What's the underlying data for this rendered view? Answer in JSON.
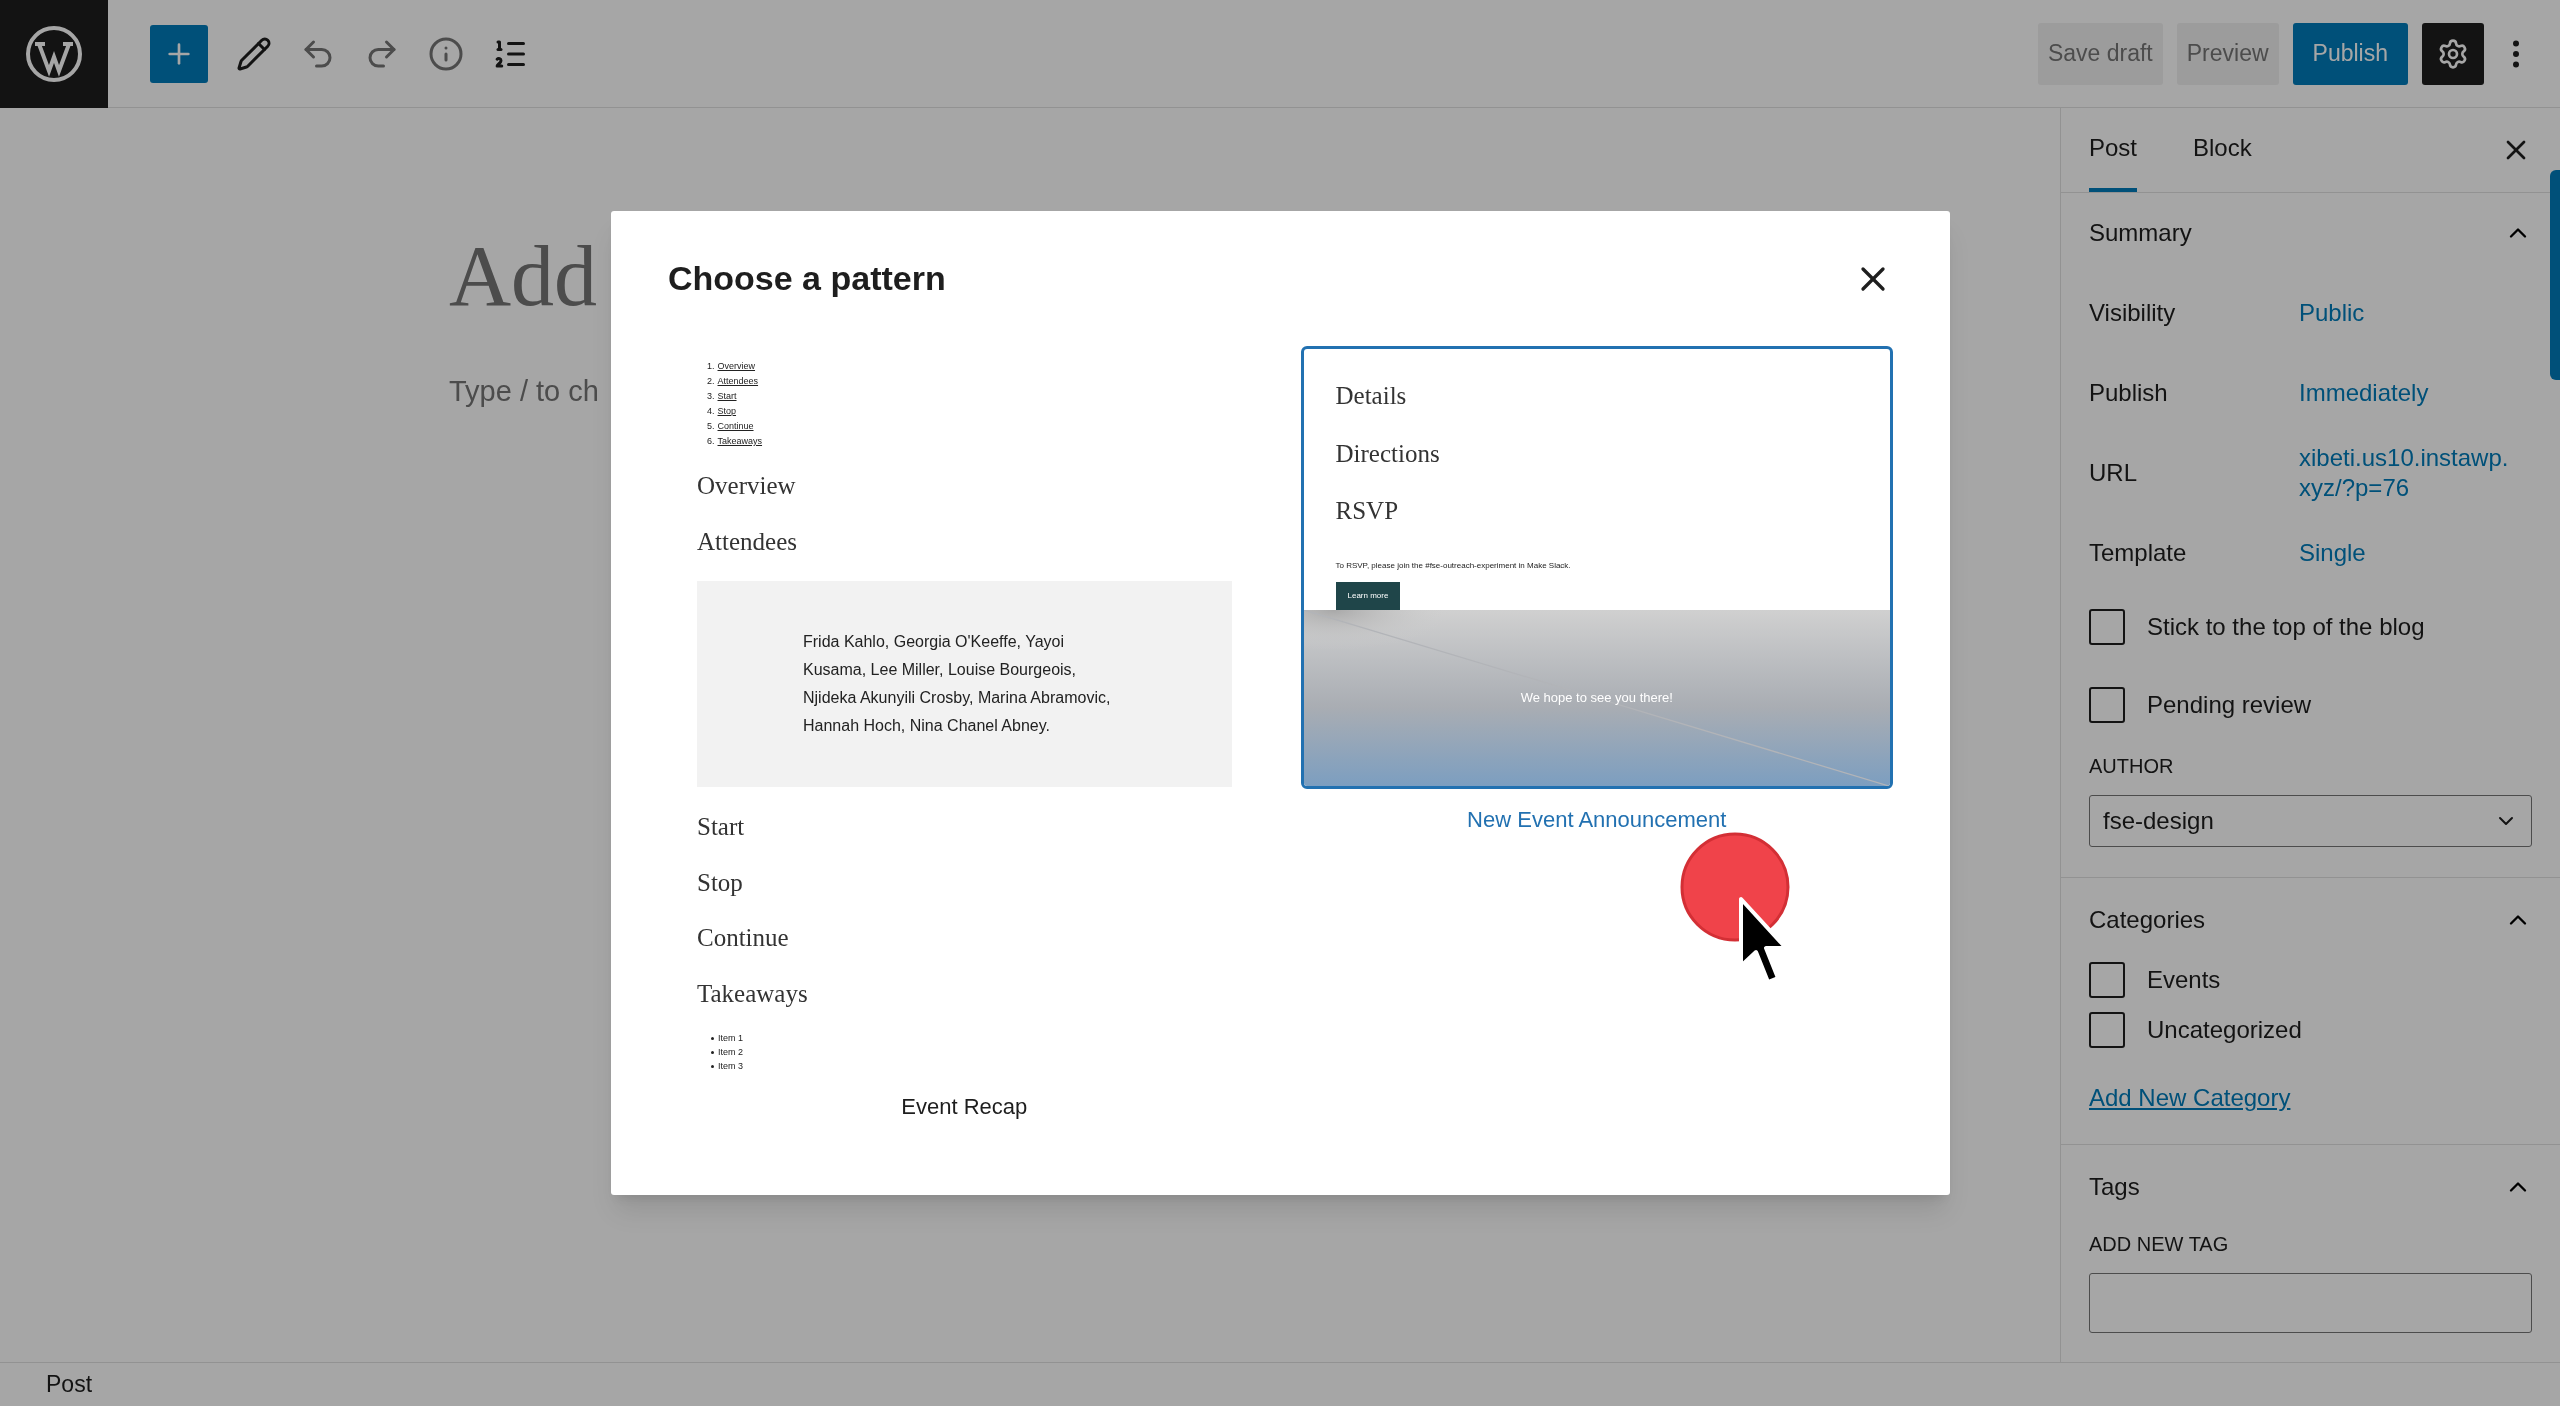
{
  "toolbar": {
    "save_draft": "Save draft",
    "preview": "Preview",
    "publish": "Publish"
  },
  "editor": {
    "title_placeholder": "Add",
    "body_placeholder": "Type / to ch"
  },
  "modal": {
    "title": "Choose a pattern",
    "patterns": [
      {
        "caption": "Event Recap",
        "selected": false,
        "blocks": [
          {
            "kind": "toc",
            "items": [
              {
                "number": "1.",
                "text": "Overview"
              },
              {
                "number": "2.",
                "text": "Attendees"
              },
              {
                "number": "3.",
                "text": "Start"
              },
              {
                "number": "4.",
                "text": "Stop"
              },
              {
                "number": "5.",
                "text": "Continue"
              },
              {
                "number": "6.",
                "text": "Takeaways"
              }
            ]
          },
          {
            "kind": "heading",
            "text": "Overview"
          },
          {
            "kind": "heading",
            "text": "Attendees"
          },
          {
            "kind": "quote_box",
            "text": "Frida Kahlo, Georgia O'Keeffe, Yayoi Kusama, Lee Miller, Louise Bourgeois, Njideka Akunyili Crosby, Marina Abramovic, Hannah Hoch, Nina Chanel Abney."
          },
          {
            "kind": "heading",
            "text": "Start"
          },
          {
            "kind": "heading",
            "text": "Stop"
          },
          {
            "kind": "heading",
            "text": "Continue"
          },
          {
            "kind": "heading",
            "text": "Takeaways"
          },
          {
            "kind": "bullets",
            "items": [
              "Item 1",
              "Item 2",
              "Item 3"
            ]
          }
        ]
      },
      {
        "caption": "New Event Announcement",
        "selected": true,
        "blocks": [
          {
            "kind": "heading",
            "text": "Details"
          },
          {
            "kind": "heading",
            "text": "Directions"
          },
          {
            "kind": "heading",
            "text": "RSVP"
          },
          {
            "kind": "small_text",
            "text": "To RSVP, please join the #fse-outreach-experiment in Make Slack."
          },
          {
            "kind": "button",
            "text": "Learn more"
          },
          {
            "kind": "cover",
            "text": "We hope to see you there!"
          }
        ]
      }
    ]
  },
  "sidebar": {
    "tabs": [
      {
        "label": "Post",
        "selected": true
      },
      {
        "label": "Block",
        "selected": false
      }
    ],
    "summary": {
      "title": "Summary",
      "expanded": true,
      "rows": [
        {
          "label": "Visibility",
          "value": "Public"
        },
        {
          "label": "Publish",
          "value": "Immediately"
        },
        {
          "label": "URL",
          "value": "xibeti.us10.instawp.\nxyz/?p=76"
        },
        {
          "label": "Template",
          "value": "Single"
        }
      ],
      "checkboxes": [
        {
          "label": "Stick to the top of the blog",
          "checked": false
        },
        {
          "label": "Pending review",
          "checked": false
        }
      ],
      "author": {
        "label": "AUTHOR",
        "value": "fse-design"
      }
    },
    "categories": {
      "title": "Categories",
      "expanded": true,
      "items": [
        {
          "label": "Events",
          "checked": false
        },
        {
          "label": "Uncategorized",
          "checked": false
        }
      ],
      "link": "Add New Category"
    },
    "tags": {
      "title": "Tags",
      "expanded": true,
      "field_label": "ADD NEW TAG"
    }
  },
  "status_bar": {
    "label": "Post"
  }
}
